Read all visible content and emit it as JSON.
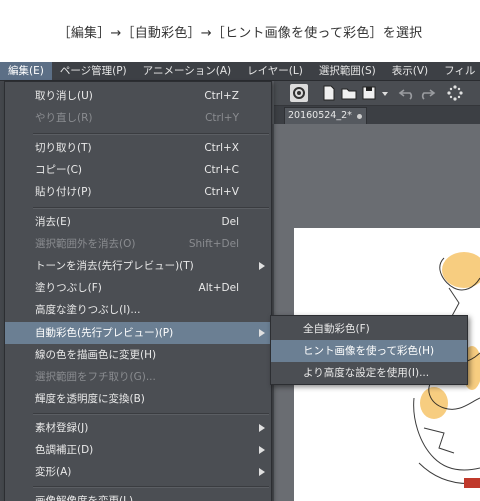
{
  "caption": "［編集］→［自動彩色］→［ヒント画像を使って彩色］を選択",
  "menubar": {
    "items": [
      "編集(E)",
      "ページ管理(P)",
      "アニメーション(A)",
      "レイヤー(L)",
      "選択範囲(S)",
      "表示(V)",
      "フィル"
    ]
  },
  "document": {
    "tab_title": "20160524_2*"
  },
  "edit_menu": {
    "items": [
      {
        "label": "取り消し(U)",
        "shortcut": "Ctrl+Z"
      },
      {
        "label": "やり直し(R)",
        "shortcut": "Ctrl+Y"
      },
      {
        "label": "切り取り(T)",
        "shortcut": "Ctrl+X"
      },
      {
        "label": "コピー(C)",
        "shortcut": "Ctrl+C"
      },
      {
        "label": "貼り付け(P)",
        "shortcut": "Ctrl+V"
      },
      {
        "label": "消去(E)",
        "shortcut": "Del"
      },
      {
        "label": "選択範囲外を消去(O)",
        "shortcut": "Shift+Del"
      },
      {
        "label": "トーンを消去(先行プレビュー)(T)",
        "shortcut": ""
      },
      {
        "label": "塗りつぶし(F)",
        "shortcut": "Alt+Del"
      },
      {
        "label": "高度な塗りつぶし(I)...",
        "shortcut": ""
      },
      {
        "label": "自動彩色(先行プレビュー)(P)",
        "shortcut": ""
      },
      {
        "label": "線の色を描画色に変更(H)",
        "shortcut": ""
      },
      {
        "label": "選択範囲をフチ取り(G)...",
        "shortcut": ""
      },
      {
        "label": "輝度を透明度に変換(B)",
        "shortcut": ""
      },
      {
        "label": "素材登録(J)",
        "shortcut": ""
      },
      {
        "label": "色調補正(D)",
        "shortcut": ""
      },
      {
        "label": "変形(A)",
        "shortcut": ""
      },
      {
        "label": "画像解像度を変更(L)...",
        "shortcut": ""
      }
    ]
  },
  "auto_color_submenu": {
    "items": [
      "全自動彩色(F)",
      "ヒント画像を使って彩色(H)",
      "より高度な設定を使用(I)..."
    ]
  },
  "colors": {
    "menubar_bg": "#3d4045",
    "menu_bg": "#4b4e53",
    "highlight": "#6b7f93",
    "disabled_text": "#8a8c90",
    "hair_highlight": "#f7c873"
  }
}
